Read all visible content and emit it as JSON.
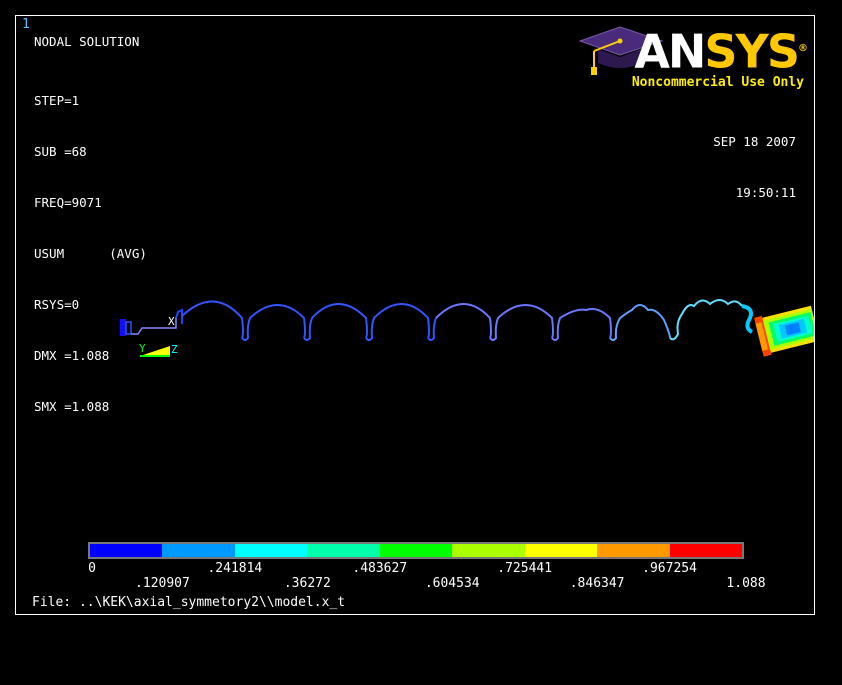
{
  "window_number": "1",
  "info": {
    "title": "NODAL SOLUTION",
    "lines": [
      "STEP=1",
      "SUB =68",
      "FREQ=9071",
      "USUM      (AVG)",
      "RSYS=0",
      "DMX =1.088",
      "SMX =1.088"
    ]
  },
  "datetime": {
    "date": "SEP 18 2007",
    "time": "19:50:11"
  },
  "logo": {
    "word_a": "AN",
    "word_b": "SYS",
    "registered": "®",
    "subtitle": "Noncommercial Use Only"
  },
  "triad": {
    "x": "X",
    "y": "Y",
    "z": "Z"
  },
  "legend": {
    "top_labels": [
      "0",
      ".241814",
      ".483627",
      ".725441",
      ".967254"
    ],
    "bottom_labels": [
      ".120907",
      ".36272",
      ".604534",
      ".846347",
      "1.088"
    ],
    "colors": [
      "#0000ff",
      "#0099ff",
      "#00ffff",
      "#00ffaa",
      "#00ff00",
      "#aaff00",
      "#ffff00",
      "#ff9900",
      "#ff0000"
    ]
  },
  "file_line": "File: ..\\KEK\\axial_symmetory2\\\\model.x_t"
}
